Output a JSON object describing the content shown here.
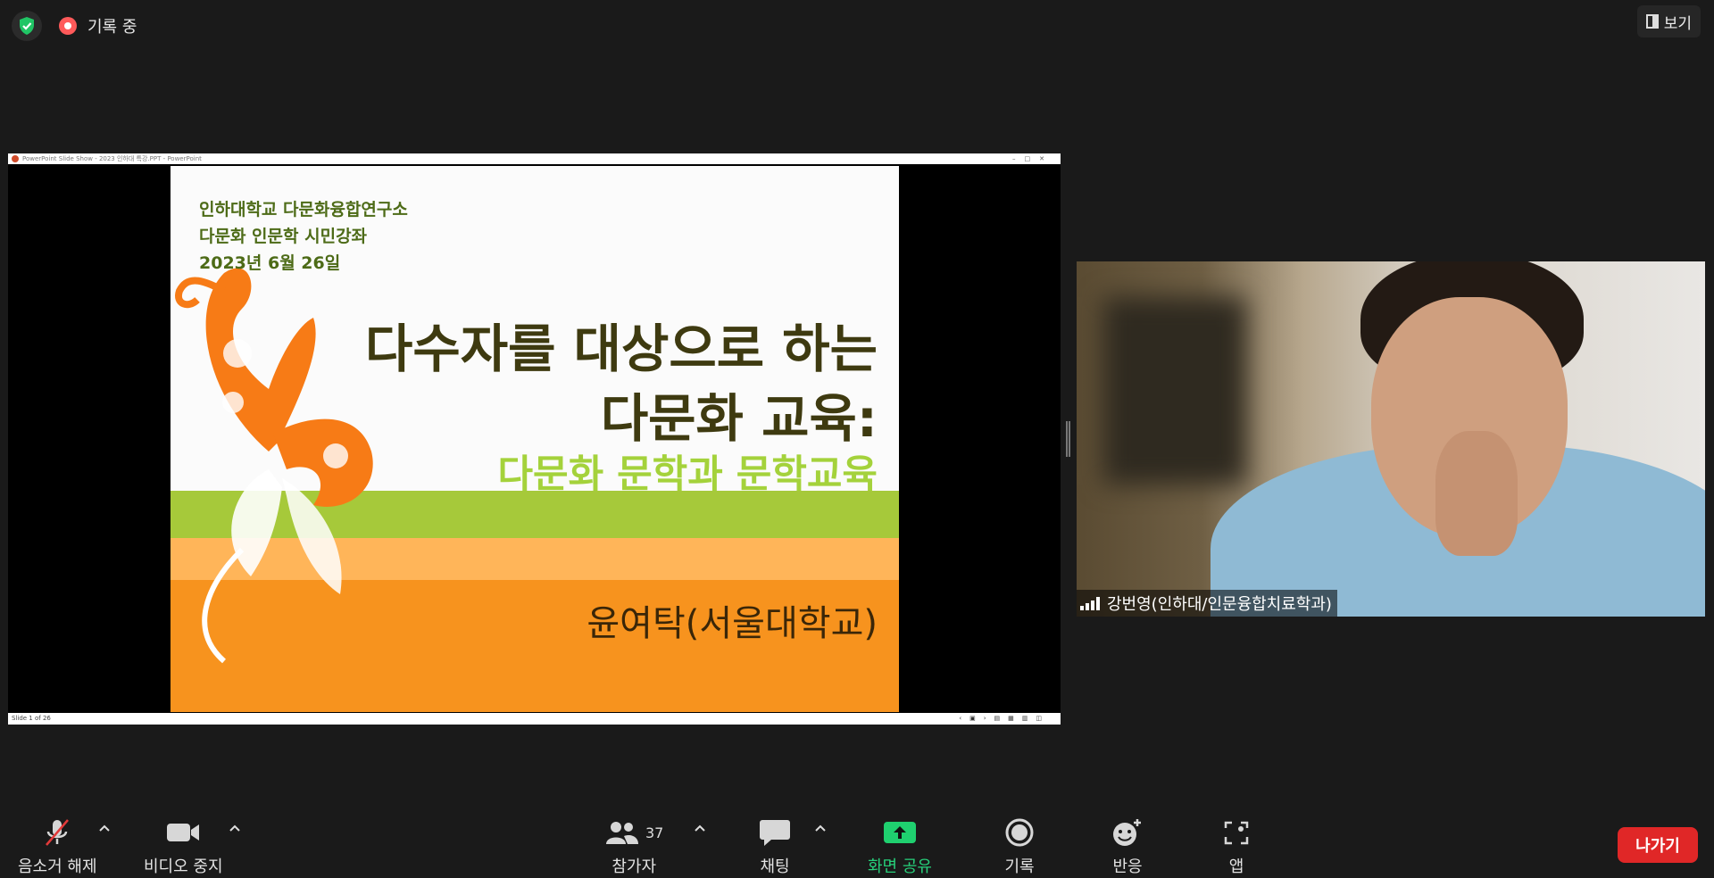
{
  "top_bar": {
    "recording_label": "기록 중",
    "view_label": "보기"
  },
  "shared_window": {
    "title": "PowerPoint Slide Show - 2023 인하대 특강.PPT - PowerPoint",
    "status": "Slide 1 of 26",
    "slide": {
      "org_lines": [
        "인하대학교 다문화융합연구소",
        "다문화 인문학 시민강좌",
        "2023년 6월 26일"
      ],
      "title_lines": [
        "다수자를 대상으로 하는",
        "다문화 교육:"
      ],
      "subtitle": "다문화 문학과 문학교육",
      "speaker": "윤여탁(서울대학교)"
    }
  },
  "participant": {
    "name": "강번영(인하대/인문융합치료학과)"
  },
  "toolbar": {
    "mute_label": "음소거 해제",
    "video_label": "비디오 중지",
    "participants_label": "참가자",
    "participants_count": "37",
    "chat_label": "채팅",
    "share_label": "화면 공유",
    "record_label": "기록",
    "reactions_label": "반응",
    "apps_label": "앱",
    "leave_label": "나가기"
  },
  "colors": {
    "background": "#1a1a1a",
    "share_green": "#27d07a",
    "leave_red": "#e02727",
    "slide_green": "#a6c93a",
    "slide_orange": "#f7931e"
  }
}
